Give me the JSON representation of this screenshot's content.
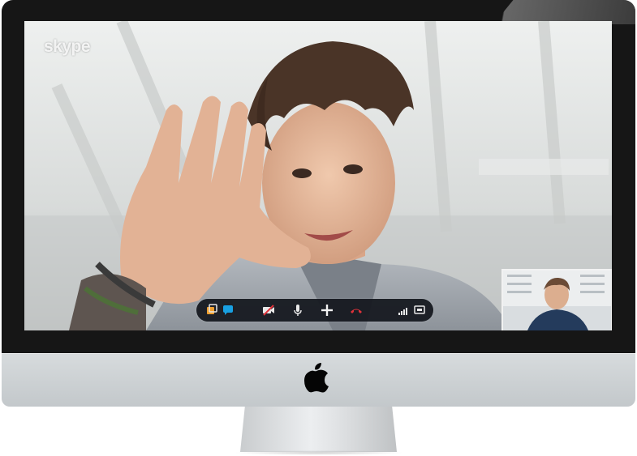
{
  "app": {
    "brand_logo_text": "skype"
  },
  "call_toolbar": {
    "buttons": [
      {
        "name": "show-contacts-button",
        "icon": "contacts-icon"
      },
      {
        "name": "chat-button",
        "icon": "chat-bubble-icon"
      },
      {
        "name": "toggle-video-button",
        "icon": "video-off-icon"
      },
      {
        "name": "mute-microphone-button",
        "icon": "microphone-icon"
      },
      {
        "name": "add-participant-button",
        "icon": "plus-icon"
      },
      {
        "name": "end-call-button",
        "icon": "hang-up-phone-icon"
      },
      {
        "name": "call-quality-button",
        "icon": "signal-bars-icon"
      },
      {
        "name": "fullscreen-button",
        "icon": "screen-icon"
      }
    ]
  },
  "colors": {
    "toolbar_bg": "#12161c",
    "accent_blue": "#18a0e2",
    "hang_up_red": "#e0323a",
    "video_off_red": "#e0323a"
  }
}
